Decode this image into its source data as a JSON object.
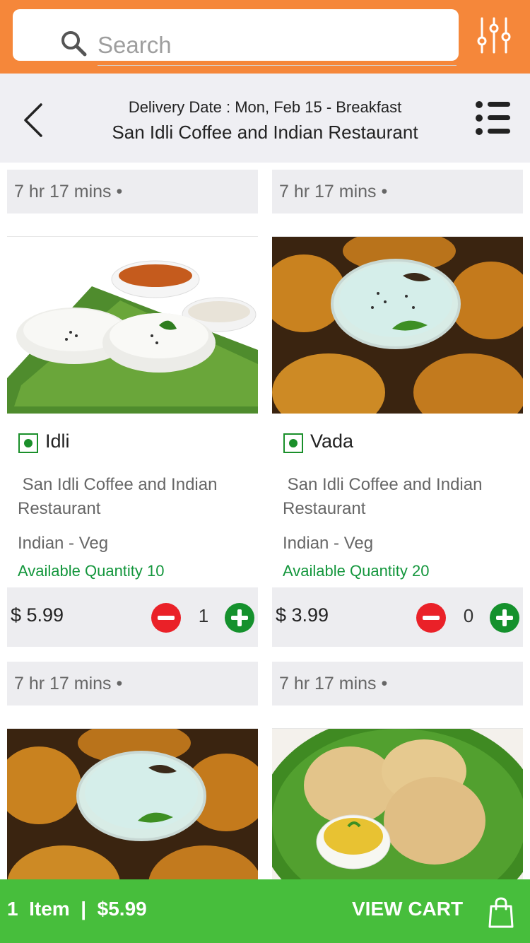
{
  "search": {
    "placeholder": "Search"
  },
  "header": {
    "delivery_date": "Delivery Date : Mon, Feb 15 - Breakfast",
    "restaurant_name": "San Idli Coffee and Indian Restaurant"
  },
  "items": [
    {
      "time": "7 hr 17 mins •",
      "name": "Idli",
      "restaurant": "San Idli Coffee and Indian Restaurant",
      "cuisine": "Indian - Veg",
      "availability": "Available Quantity 10",
      "price": "$ 5.99",
      "count": "1",
      "image": "idli"
    },
    {
      "time": "7 hr 17 mins •",
      "name": "Vada",
      "restaurant": "San Idli Coffee and Indian Restaurant",
      "cuisine": "Indian - Veg",
      "availability": "Available Quantity 20",
      "price": "$ 3.99",
      "count": "0",
      "image": "vada"
    },
    {
      "time": "7 hr 17 mins •",
      "image": "vada"
    },
    {
      "time": "7 hr 17 mins •",
      "image": "poori"
    }
  ],
  "cart": {
    "summary": "1  Item  |  $5.99",
    "view_cart_label": "VIEW CART"
  },
  "colors": {
    "topbar": "#f5873a",
    "cartbar": "#47be3c",
    "available": "#13963c",
    "minus": "#ea2128",
    "plus": "#15912d"
  },
  "icons": [
    "search-icon",
    "filter-sliders-icon",
    "back-chevron-icon",
    "list-icon",
    "veg-icon",
    "minus-icon",
    "plus-icon",
    "shopping-bag-icon"
  ]
}
